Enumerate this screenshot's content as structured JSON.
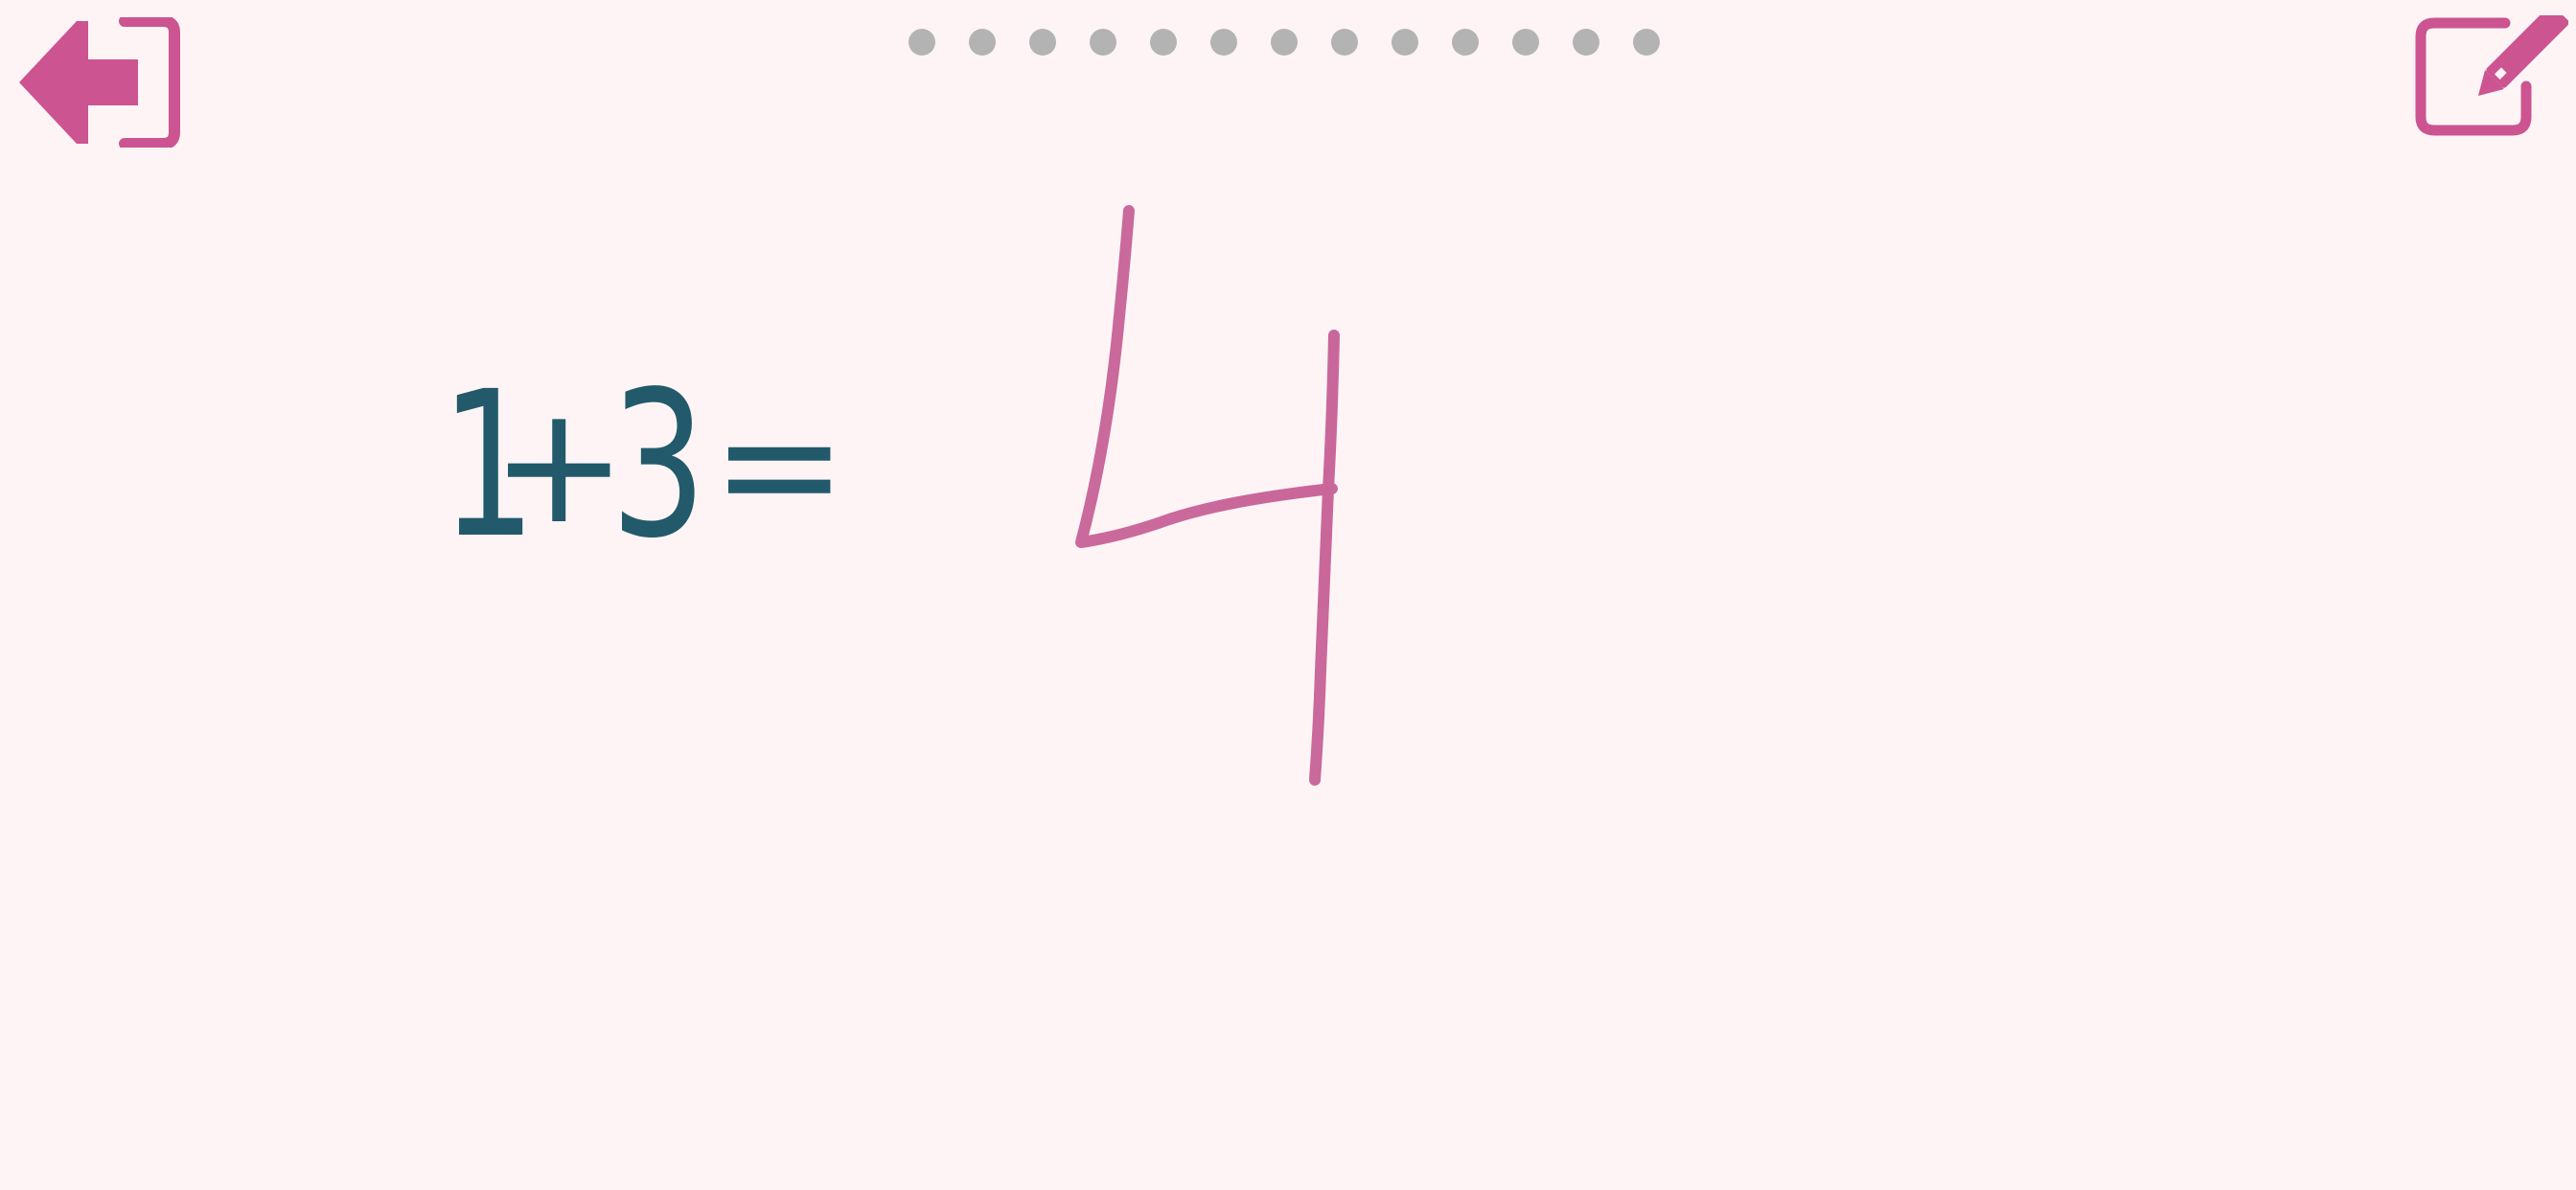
{
  "colors": {
    "background": "#fef4f5",
    "accent": "#cc5490",
    "equation_text": "#225a6b",
    "dot_inactive": "#b3b3b3",
    "ink": "#c65c93"
  },
  "header": {
    "exit_icon": "exit-arrow-icon",
    "edit_icon": "edit-pencil-icon",
    "progress": {
      "total": 13,
      "current": 0
    }
  },
  "problem": {
    "operand_a": "1",
    "operator": "+",
    "operand_b": "3",
    "equals": "="
  },
  "answer": {
    "handwritten_value": "4"
  }
}
